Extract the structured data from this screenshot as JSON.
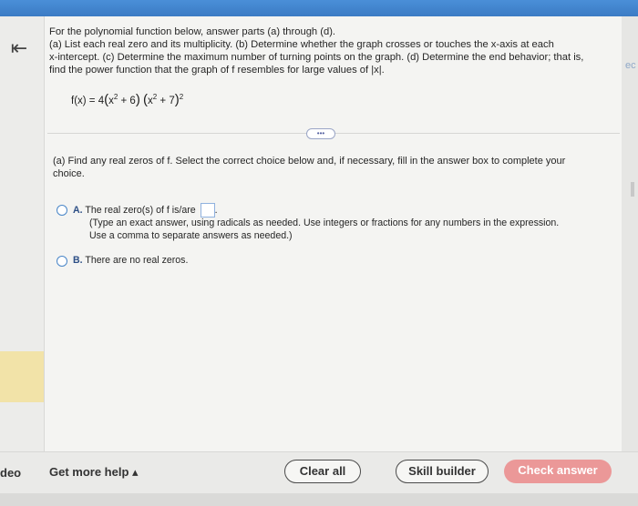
{
  "intro": {
    "line1": "For the polynomial function below, answer parts (a) through (d).",
    "line2": "(a) List each real zero and its multiplicity. (b) Determine whether the graph crosses or touches the x-axis at each",
    "line3": "x-intercept. (c) Determine the maximum number of turning points on the graph. (d) Determine the end behavior; that is,",
    "line4": "find the power function that the graph of f resembles for large values of |x|."
  },
  "function": {
    "lhs": "f(x) = 4",
    "factor1_base": "x",
    "factor1_exp": "2",
    "factor1_rest": " + 6",
    "factor2_base": "x",
    "factor2_exp": "2",
    "factor2_rest": " + 7",
    "outer_exp": "2"
  },
  "expand_label": "•••",
  "part_a": {
    "prompt_line1": "(a) Find any real zeros of f. Select the correct choice below and, if necessary, fill in the answer box to complete your",
    "prompt_line2": "choice."
  },
  "choices": {
    "a_letter": "A.",
    "a_text": "The real zero(s) of f is/are",
    "a_hint1": "(Type an exact answer, using radicals as needed. Use integers or fractions for any numbers in the expression.",
    "a_hint2": "Use a comma to separate answers as needed.)",
    "b_letter": "B.",
    "b_text": "There are no real zeros."
  },
  "sidebar": {
    "back_glyph": "⇤",
    "right_clip": "ec"
  },
  "bottom": {
    "left_clip": "deo",
    "help_label": "Get more help ▴",
    "clear_label": "Clear all",
    "skill_label": "Skill builder",
    "check_label": "Check answer"
  }
}
